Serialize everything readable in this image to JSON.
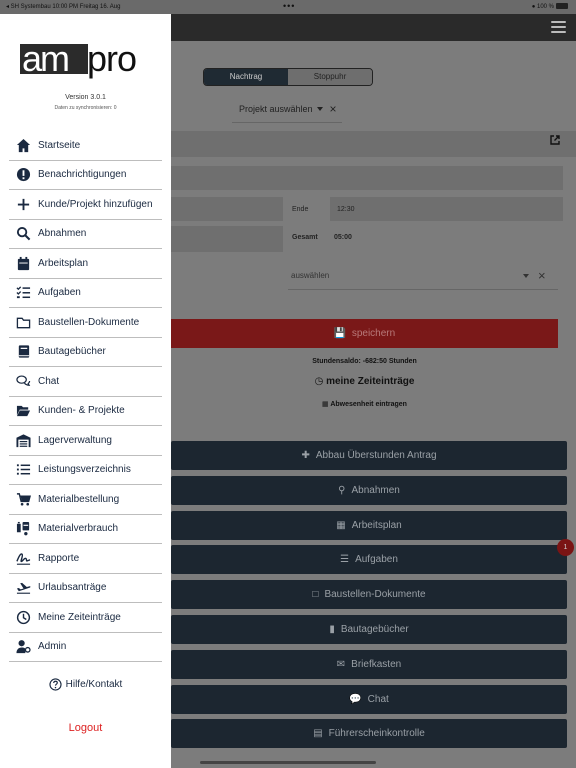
{
  "statusbar": {
    "left": "◂ SH Systembau  10:00 PM  Freitag 16. Aug",
    "center": "•••",
    "right": "100 %"
  },
  "drawer": {
    "logo_text": "ampro",
    "version": "Version 3.0.1",
    "sync": "Daten zu synchronisieren: 0",
    "items": [
      {
        "label": "Startseite",
        "icon": "home-icon"
      },
      {
        "label": "Benachrichtigungen",
        "icon": "alert-icon"
      },
      {
        "label": "Kunde/Projekt hinzufügen",
        "icon": "plus-icon"
      },
      {
        "label": "Abnahmen",
        "icon": "search-icon"
      },
      {
        "label": "Arbeitsplan",
        "icon": "calendar-icon"
      },
      {
        "label": "Aufgaben",
        "icon": "tasks-icon"
      },
      {
        "label": "Baustellen-Dokumente",
        "icon": "folder-icon"
      },
      {
        "label": "Bautagebücher",
        "icon": "book-icon"
      },
      {
        "label": "Chat",
        "icon": "chat-icon"
      },
      {
        "label": "Kunden- & Projekte",
        "icon": "folder-open-icon"
      },
      {
        "label": "Lagerverwaltung",
        "icon": "warehouse-icon"
      },
      {
        "label": "Leistungsverzeichnis",
        "icon": "list-icon"
      },
      {
        "label": "Materialbestellung",
        "icon": "cart-icon"
      },
      {
        "label": "Materialverbrauch",
        "icon": "dolly-icon"
      },
      {
        "label": "Rapporte",
        "icon": "signature-icon"
      },
      {
        "label": "Urlaubsanträge",
        "icon": "plane-icon"
      },
      {
        "label": "Meine Zeiteinträge",
        "icon": "clock-icon"
      },
      {
        "label": "Admin",
        "icon": "user-gear-icon"
      }
    ],
    "help": "Hilfe/Kontakt",
    "logout": "Logout"
  },
  "main": {
    "segment": {
      "active": "Nachtrag",
      "inactive": "Stoppuhr"
    },
    "project_select": "Projekt auswählen",
    "ende_label": "Ende",
    "ende_value": "12:30",
    "gesamt_label": "Gesamt",
    "gesamt_value": "05:00",
    "select_placeholder": "auswählen",
    "save": "speichern",
    "saldo": "Stundensaldo: -682:50 Stunden",
    "zeiteintraege": "meine Zeiteinträge",
    "abwesenheit": "Abwesenheit eintragen",
    "buttons": [
      {
        "label": "Abbau Überstunden Antrag",
        "icon": "medkit-icon"
      },
      {
        "label": "Abnahmen",
        "icon": "search-icon"
      },
      {
        "label": "Arbeitsplan",
        "icon": "calendar-icon"
      },
      {
        "label": "Aufgaben",
        "icon": "tasks-icon"
      },
      {
        "label": "Baustellen-Dokumente",
        "icon": "folder-icon"
      },
      {
        "label": "Bautagebücher",
        "icon": "book-icon"
      },
      {
        "label": "Briefkasten",
        "icon": "mail-icon"
      },
      {
        "label": "Chat",
        "icon": "chat-icon"
      },
      {
        "label": "Führerscheinkontrolle",
        "icon": "document-icon"
      }
    ],
    "badge": "1"
  }
}
